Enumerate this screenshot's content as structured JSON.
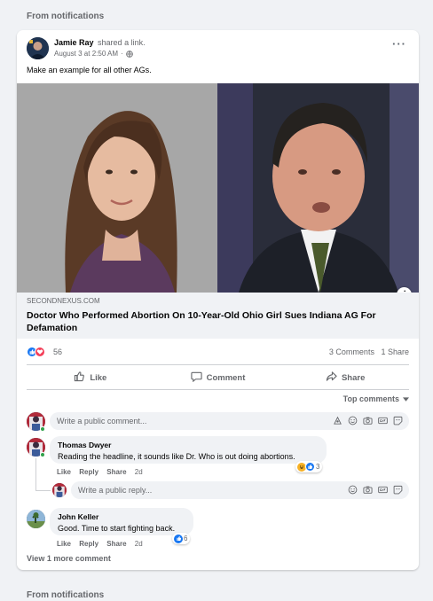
{
  "section_label": "From notifications",
  "post": {
    "author": "Jamie Ray",
    "verb": "shared a link.",
    "timestamp": "August 3 at 2:50 AM",
    "dot": "·",
    "text": "Make an example for all other AGs.",
    "link": {
      "domain": "SECONDNEXUS.COM",
      "title": "Doctor Who Performed Abortion On 10-Year-Old Ohio Girl Sues Indiana AG For Defamation"
    },
    "reaction_count": "56",
    "comments_count": "3 Comments",
    "shares_count": "1 Share"
  },
  "actions": {
    "like": "Like",
    "comment": "Comment",
    "share": "Share"
  },
  "top_comments_label": "Top comments",
  "comment_placeholder": "Write a public comment...",
  "reply_placeholder": "Write a public reply...",
  "comments": [
    {
      "author": "Thomas Dwyer",
      "text": "Reading the headline, it sounds like Dr. Who is out doing abortions.",
      "like": "Like",
      "reply": "Reply",
      "share": "Share",
      "time": "2d",
      "reaction_count": "3"
    },
    {
      "author": "John Keller",
      "text": "Good. Time to start fighting back.",
      "like": "Like",
      "reply": "Reply",
      "share": "Share",
      "time": "2d",
      "reaction_count": "6"
    }
  ],
  "view_more": "View 1 more comment",
  "icons": {
    "post_more": "more-options-icon",
    "privacy": "globe-icon",
    "info": "info-icon",
    "like": "thumbs-up-icon",
    "comment": "speech-bubble-icon",
    "share": "share-arrow-icon",
    "box": [
      "sticker-icon",
      "emoji-icon",
      "camera-icon",
      "gif-icon",
      "sticker-square-icon"
    ]
  },
  "colors": {
    "accent": "#1877f2",
    "love": "#f33e58",
    "haha": "#f7b125",
    "online": "#31a24c"
  }
}
